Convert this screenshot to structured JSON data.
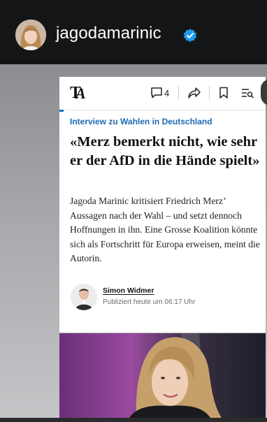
{
  "story": {
    "username": "jagodamarinic",
    "verified_icon": "verified-badge-icon",
    "accent_color": "#1e9bf0"
  },
  "article": {
    "toolbar": {
      "comment_count": "4",
      "icons": [
        "comment-icon",
        "share-icon",
        "bookmark-icon",
        "reading-list-icon"
      ]
    },
    "kicker": "Interview zu Wahlen in Deutschland",
    "headline": "«Merz bemerkt nicht, wie sehr er der AfD in die Hände spielt»",
    "lead": "Jagoda Marinic kritisiert Friedrich Merz’ Aussagen nach der Wahl – und setzt dennoch Hoffnungen in ihn. Eine Grosse Koalition könnte sich als Fortschritt für Europa erweisen, meint die Autorin.",
    "author": {
      "name": "Simon Widmer",
      "published": "Publiziert heute um 06:17 Uhr"
    },
    "kicker_color": "#1d6bb2"
  }
}
